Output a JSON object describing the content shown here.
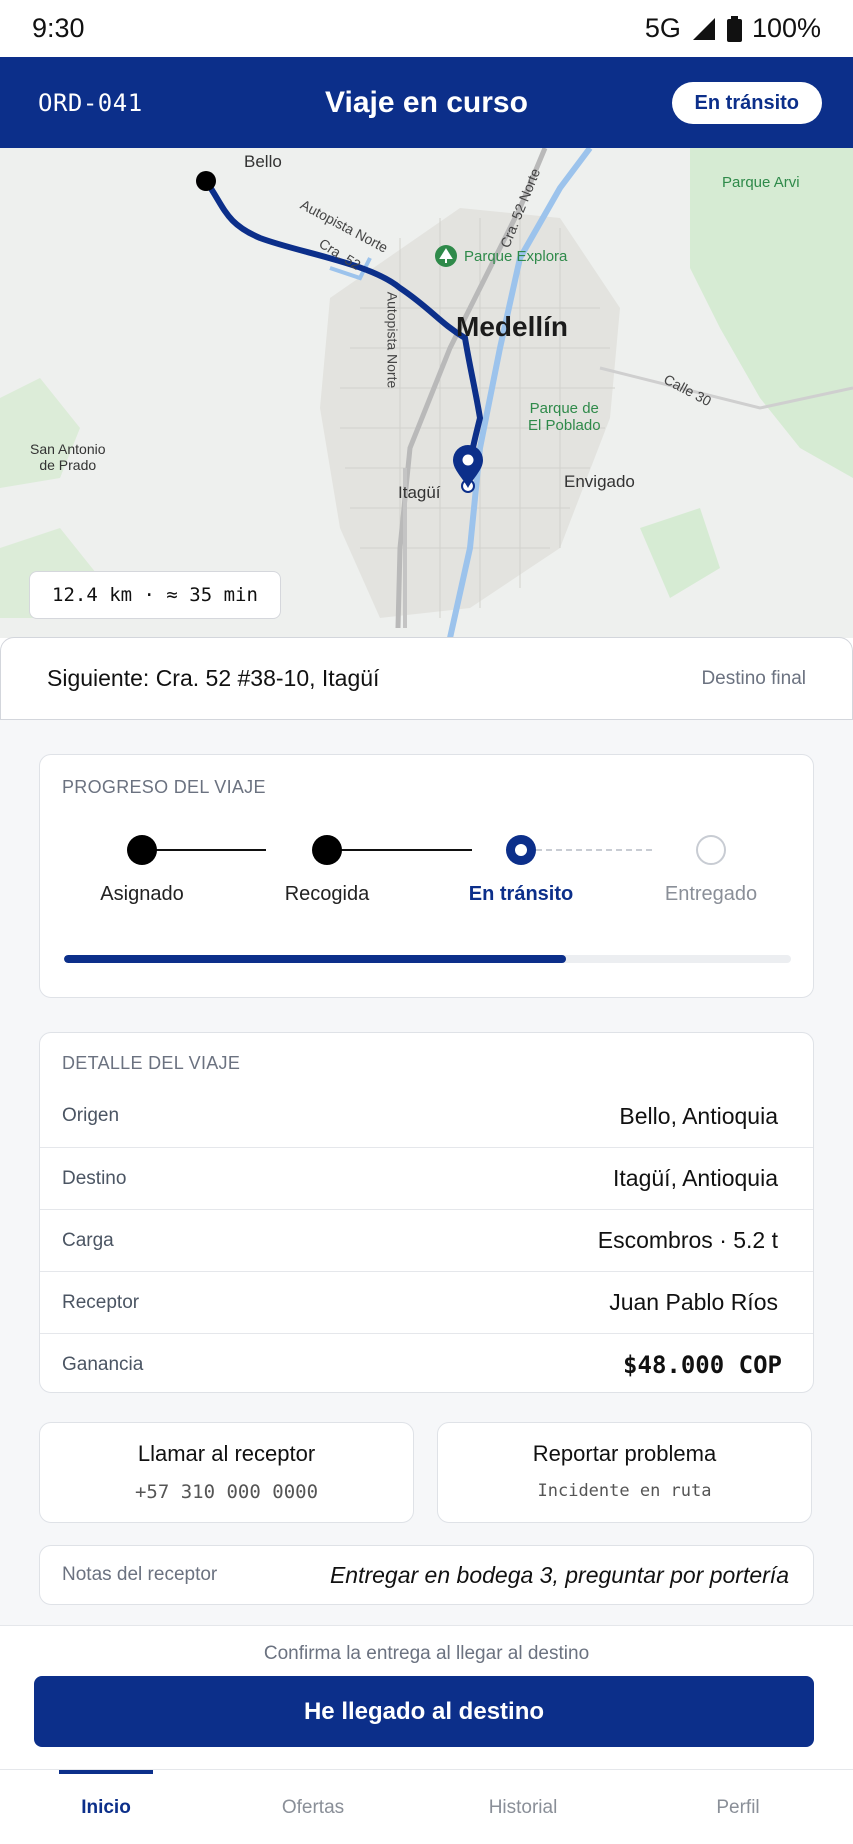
{
  "status_bar": {
    "time": "9:30",
    "network": "5G",
    "battery": "100%"
  },
  "header": {
    "order_id": "ORD-041",
    "title": "Viaje en curso",
    "status": "En tránsito"
  },
  "map": {
    "labels": {
      "bello": "Bello",
      "medellin": "Medellín",
      "autopista_norte_diag": "Autopista Norte",
      "cra52_diag": "Cra. 52",
      "cra52_norte": "Cra. 52 Norte",
      "autopista_norte_vert": "Autopista Norte",
      "parque_explora": "Parque Explora",
      "parque_arvi": "Parque Arvi",
      "parque_poblado_1": "Parque de",
      "parque_poblado_2": "El Poblado",
      "calle30": "Calle 30",
      "san_antonio_1": "San Antonio",
      "san_antonio_2": "de Prado",
      "itagui": "Itagüí",
      "envigado": "Envigado"
    },
    "distance_eta": "12.4 km · ≈ 35 min"
  },
  "next_stop": {
    "text": "Siguiente: Cra. 52 #38-10, Itagüí",
    "badge": "Destino final"
  },
  "progress": {
    "title": "PROGRESO DEL VIAJE",
    "steps": [
      {
        "label": "Asignado",
        "state": "done"
      },
      {
        "label": "Recogida",
        "state": "done"
      },
      {
        "label": "En tránsito",
        "state": "current"
      },
      {
        "label": "Entregado",
        "state": "pending"
      }
    ],
    "fraction": 0.69
  },
  "details": {
    "title": "DETALLE DEL VIAJE",
    "rows": [
      {
        "label": "Origen",
        "value": "Bello, Antioquia"
      },
      {
        "label": "Destino",
        "value": "Itagüí, Antioquia"
      },
      {
        "label": "Carga",
        "value": "Escombros · 5.2 t"
      },
      {
        "label": "Receptor",
        "value": "Juan Pablo Ríos"
      },
      {
        "label": "Ganancia",
        "value": "$48.000 COP"
      }
    ]
  },
  "actions": {
    "call": {
      "label": "Llamar al receptor",
      "sub": "+57 310 000 0000"
    },
    "report": {
      "label": "Reportar problema",
      "sub": "Incidente en ruta"
    }
  },
  "notes": {
    "label": "Notas del receptor",
    "text": "Entregar en bodega 3, preguntar por portería"
  },
  "cta": {
    "hint": "Confirma la entrega al llegar al destino",
    "button": "He llegado al destino"
  },
  "nav": {
    "items": [
      "Inicio",
      "Ofertas",
      "Historial",
      "Perfil"
    ],
    "active": "Inicio"
  },
  "colors": {
    "primary": "#0c2f8a",
    "route": "#0c2f8a",
    "park": "#2f8a4a",
    "river": "#9cc3ec"
  }
}
